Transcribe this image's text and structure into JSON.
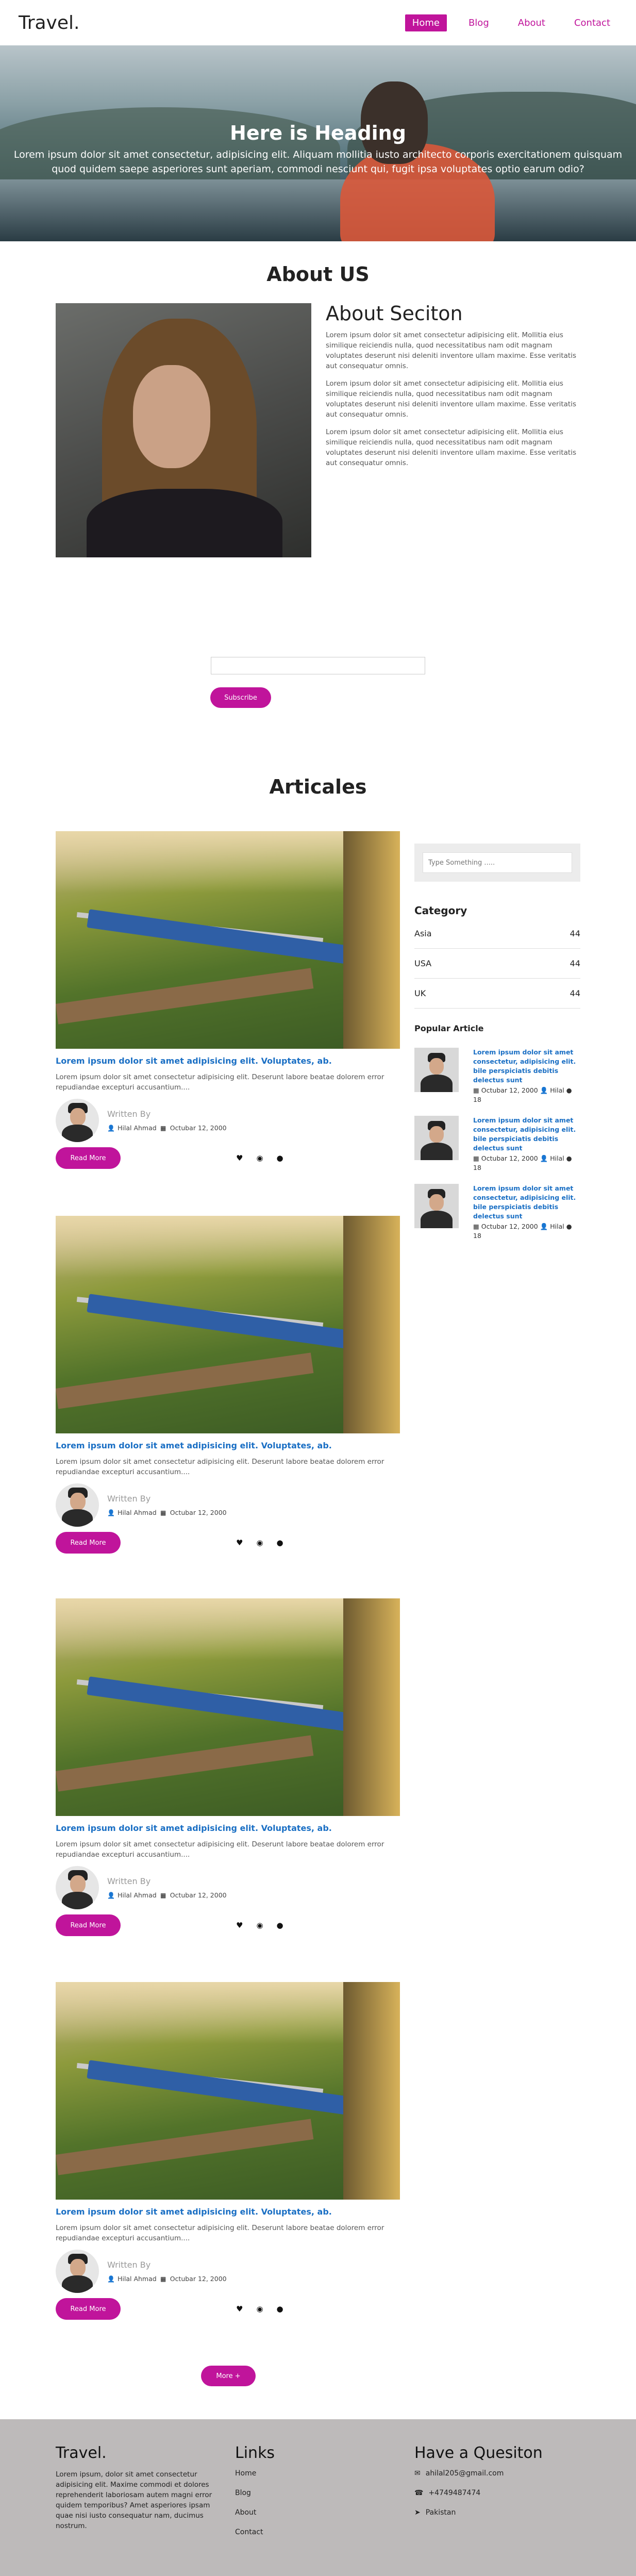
{
  "header": {
    "brand": "Travel.",
    "nav": [
      {
        "label": "Home",
        "active": true
      },
      {
        "label": "Blog"
      },
      {
        "label": "About"
      },
      {
        "label": "Contact"
      }
    ]
  },
  "hero": {
    "heading": "Here is Heading",
    "text": "Lorem ipsum dolor sit amet consectetur, adipisicing elit. Aliquam mollitia iusto architecto corporis exercitationem quisquam quod quidem saepe asperiores sunt aperiam, commodi nesciunt qui, fugit ipsa voluptates optio earum odio?"
  },
  "about": {
    "title": "About US",
    "section_title": "About Seciton",
    "paragraphs": [
      "Lorem ipsum dolor sit amet consectetur adipisicing elit. Mollitia eius similique reiciendis nulla, quod necessitatibus nam odit magnam voluptates deserunt nisi deleniti inventore ullam maxime. Esse veritatis aut consequatur omnis.",
      "Lorem ipsum dolor sit amet consectetur adipisicing elit. Mollitia eius similique reiciendis nulla, quod necessitatibus nam odit magnam voluptates deserunt nisi deleniti inventore ullam maxime. Esse veritatis aut consequatur omnis.",
      "Lorem ipsum dolor sit amet consectetur adipisicing elit. Mollitia eius similique reiciendis nulla, quod necessitatibus nam odit magnam voluptates deserunt nisi deleniti inventore ullam maxime. Esse veritatis aut consequatur omnis."
    ]
  },
  "subscribe": {
    "input_value": "",
    "button_label": "Subscribe"
  },
  "articles": {
    "title": "Articales",
    "posts": [
      {
        "title": "Lorem ipsum dolor sit amet adipisicing elit. Voluptates, ab.",
        "desc": "Lorem ipsum dolor sit amet consectetur adipisicing elit. Deserunt labore beatae dolorem error repudiandae excepturi accusantium....",
        "written_by": "Written By",
        "author": "Hilal Ahmad",
        "date": "Octubar 12, 2000",
        "read_more": "Read More"
      },
      {
        "title": "Lorem ipsum dolor sit amet adipisicing elit. Voluptates, ab.",
        "desc": "Lorem ipsum dolor sit amet consectetur adipisicing elit. Deserunt labore beatae dolorem error repudiandae excepturi accusantium....",
        "written_by": "Written By",
        "author": "Hilal Ahmad",
        "date": "Octubar 12, 2000",
        "read_more": "Read More"
      },
      {
        "title": "Lorem ipsum dolor sit amet adipisicing elit. Voluptates, ab.",
        "desc": "Lorem ipsum dolor sit amet consectetur adipisicing elit. Deserunt labore beatae dolorem error repudiandae excepturi accusantium....",
        "written_by": "Written By",
        "author": "Hilal Ahmad",
        "date": "Octubar 12, 2000",
        "read_more": "Read More"
      },
      {
        "title": "Lorem ipsum dolor sit amet adipisicing elit. Voluptates, ab.",
        "desc": "Lorem ipsum dolor sit amet consectetur adipisicing elit. Deserunt labore beatae dolorem error repudiandae excepturi accusantium....",
        "written_by": "Written By",
        "author": "Hilal Ahmad",
        "date": "Octubar 12, 2000",
        "read_more": "Read More"
      }
    ],
    "more_label": "More +"
  },
  "sidebar": {
    "search_placeholder": "Type Something .....",
    "category_heading": "Category",
    "categories": [
      {
        "name": "Asia",
        "count": "44"
      },
      {
        "name": "USA",
        "count": "44"
      },
      {
        "name": "UK",
        "count": "44"
      }
    ],
    "popular_heading": "Popular Article",
    "popular": [
      {
        "title": "Lorem ipsum dolor sit amet consectetur, adipisicing elit. bile perspiciatis debitis delectus sunt",
        "date": "Octubar 12, 2000",
        "author": "Hilal",
        "comments": "18"
      },
      {
        "title": "Lorem ipsum dolor sit amet consectetur, adipisicing elit. bile perspiciatis debitis delectus sunt",
        "date": "Octubar 12, 2000",
        "author": "Hilal",
        "comments": "18"
      },
      {
        "title": "Lorem ipsum dolor sit amet consectetur, adipisicing elit. bile perspiciatis debitis delectus sunt",
        "date": "Octubar 12, 2000",
        "author": "Hilal",
        "comments": "18"
      }
    ]
  },
  "footer": {
    "brand": "Travel.",
    "about_text": "Lorem ipsum, dolor sit amet consectetur adipisicing elit. Maxime commodi et dolores reprehenderit laboriosam autem magni error quidem temporibus? Amet asperiores ipsam quae nisi iusto consequatur nam, ducimus nostrum.",
    "links_heading": "Links",
    "links": [
      "Home",
      "Blog",
      "About",
      "Contact"
    ],
    "contact_heading": "Have a Quesiton",
    "email": "ahilal205@gmail.com",
    "phone": "+4749487474",
    "location": "Pakistan"
  },
  "colors": {
    "accent": "#c0149b",
    "link": "#1a6fc4",
    "footer_bg": "#bdbaba"
  }
}
